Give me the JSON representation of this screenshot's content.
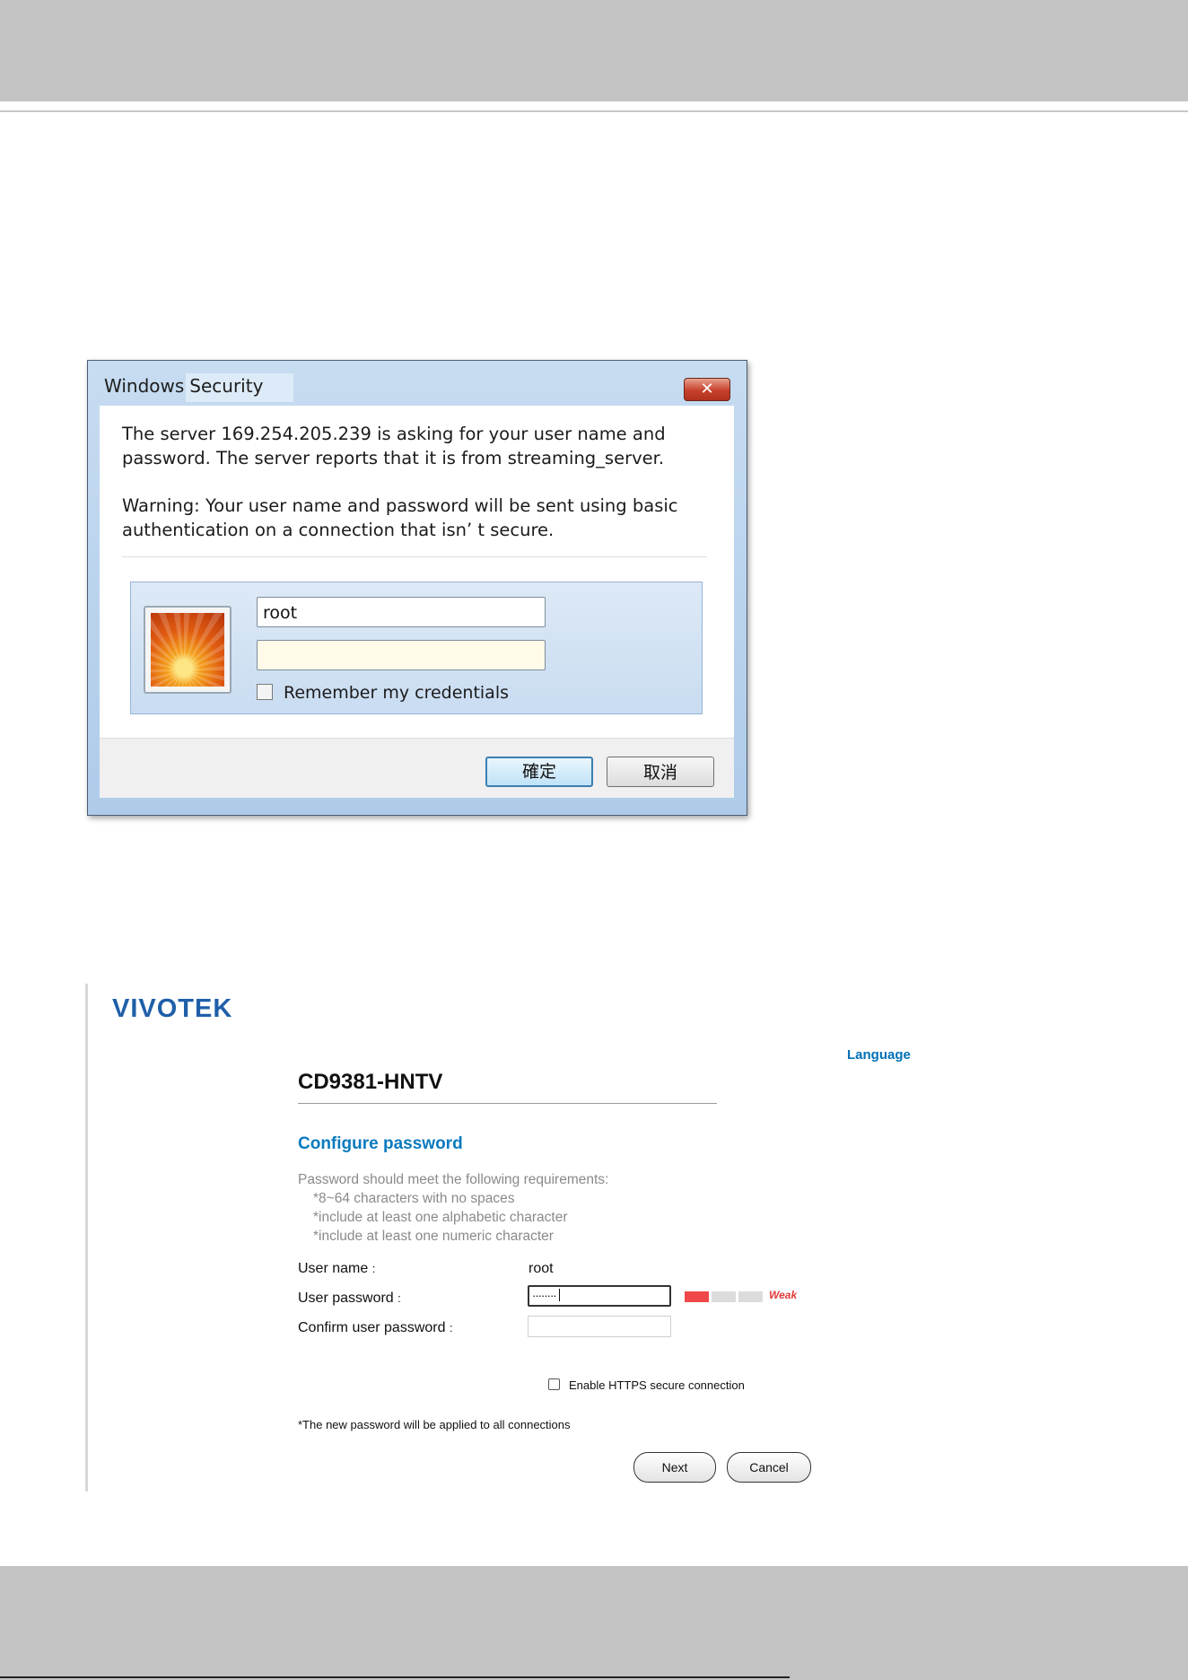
{
  "dialog": {
    "title_part1": "Windows",
    "title_part2": "Security",
    "close_glyph": "✕",
    "message_line1": "The server 169.254.205.239 is asking for your user name and password. The server reports that it is from streaming_server.",
    "message_line2": "Warning: Your user name and password will be sent using basic authentication on a connection that isn’ t secure.",
    "username_value": "root",
    "password_value": "",
    "remember_label": "Remember my credentials",
    "ok_label": "確定",
    "cancel_label": "取消",
    "avatar_icon": "user-avatar-flower-icon"
  },
  "config": {
    "logo": "VIVOTEK",
    "language_link": "Language",
    "model": "CD9381-HNTV",
    "heading": "Configure password",
    "requirements_intro": "Password should meet the following requirements:",
    "requirements": [
      "*8~64 characters with no spaces",
      "*include at least one alphabetic character",
      "*include at least one numeric character"
    ],
    "username_label": "User name",
    "username_value": "root",
    "password_label": "User password",
    "password_mask": "········",
    "confirm_label": "Confirm user password",
    "colon": ":",
    "strength_label": "Weak",
    "strength_level": 1,
    "strength_levels_total": 3,
    "https_label": "Enable HTTPS secure connection",
    "https_checked": false,
    "note": "*The new password will be applied to all connections",
    "next_label": "Next",
    "cancel_label": "Cancel"
  },
  "colors": {
    "dialog_frame": "#aecbe9",
    "accent_blue": "#0a7abf",
    "strength_weak": "#f04848"
  }
}
